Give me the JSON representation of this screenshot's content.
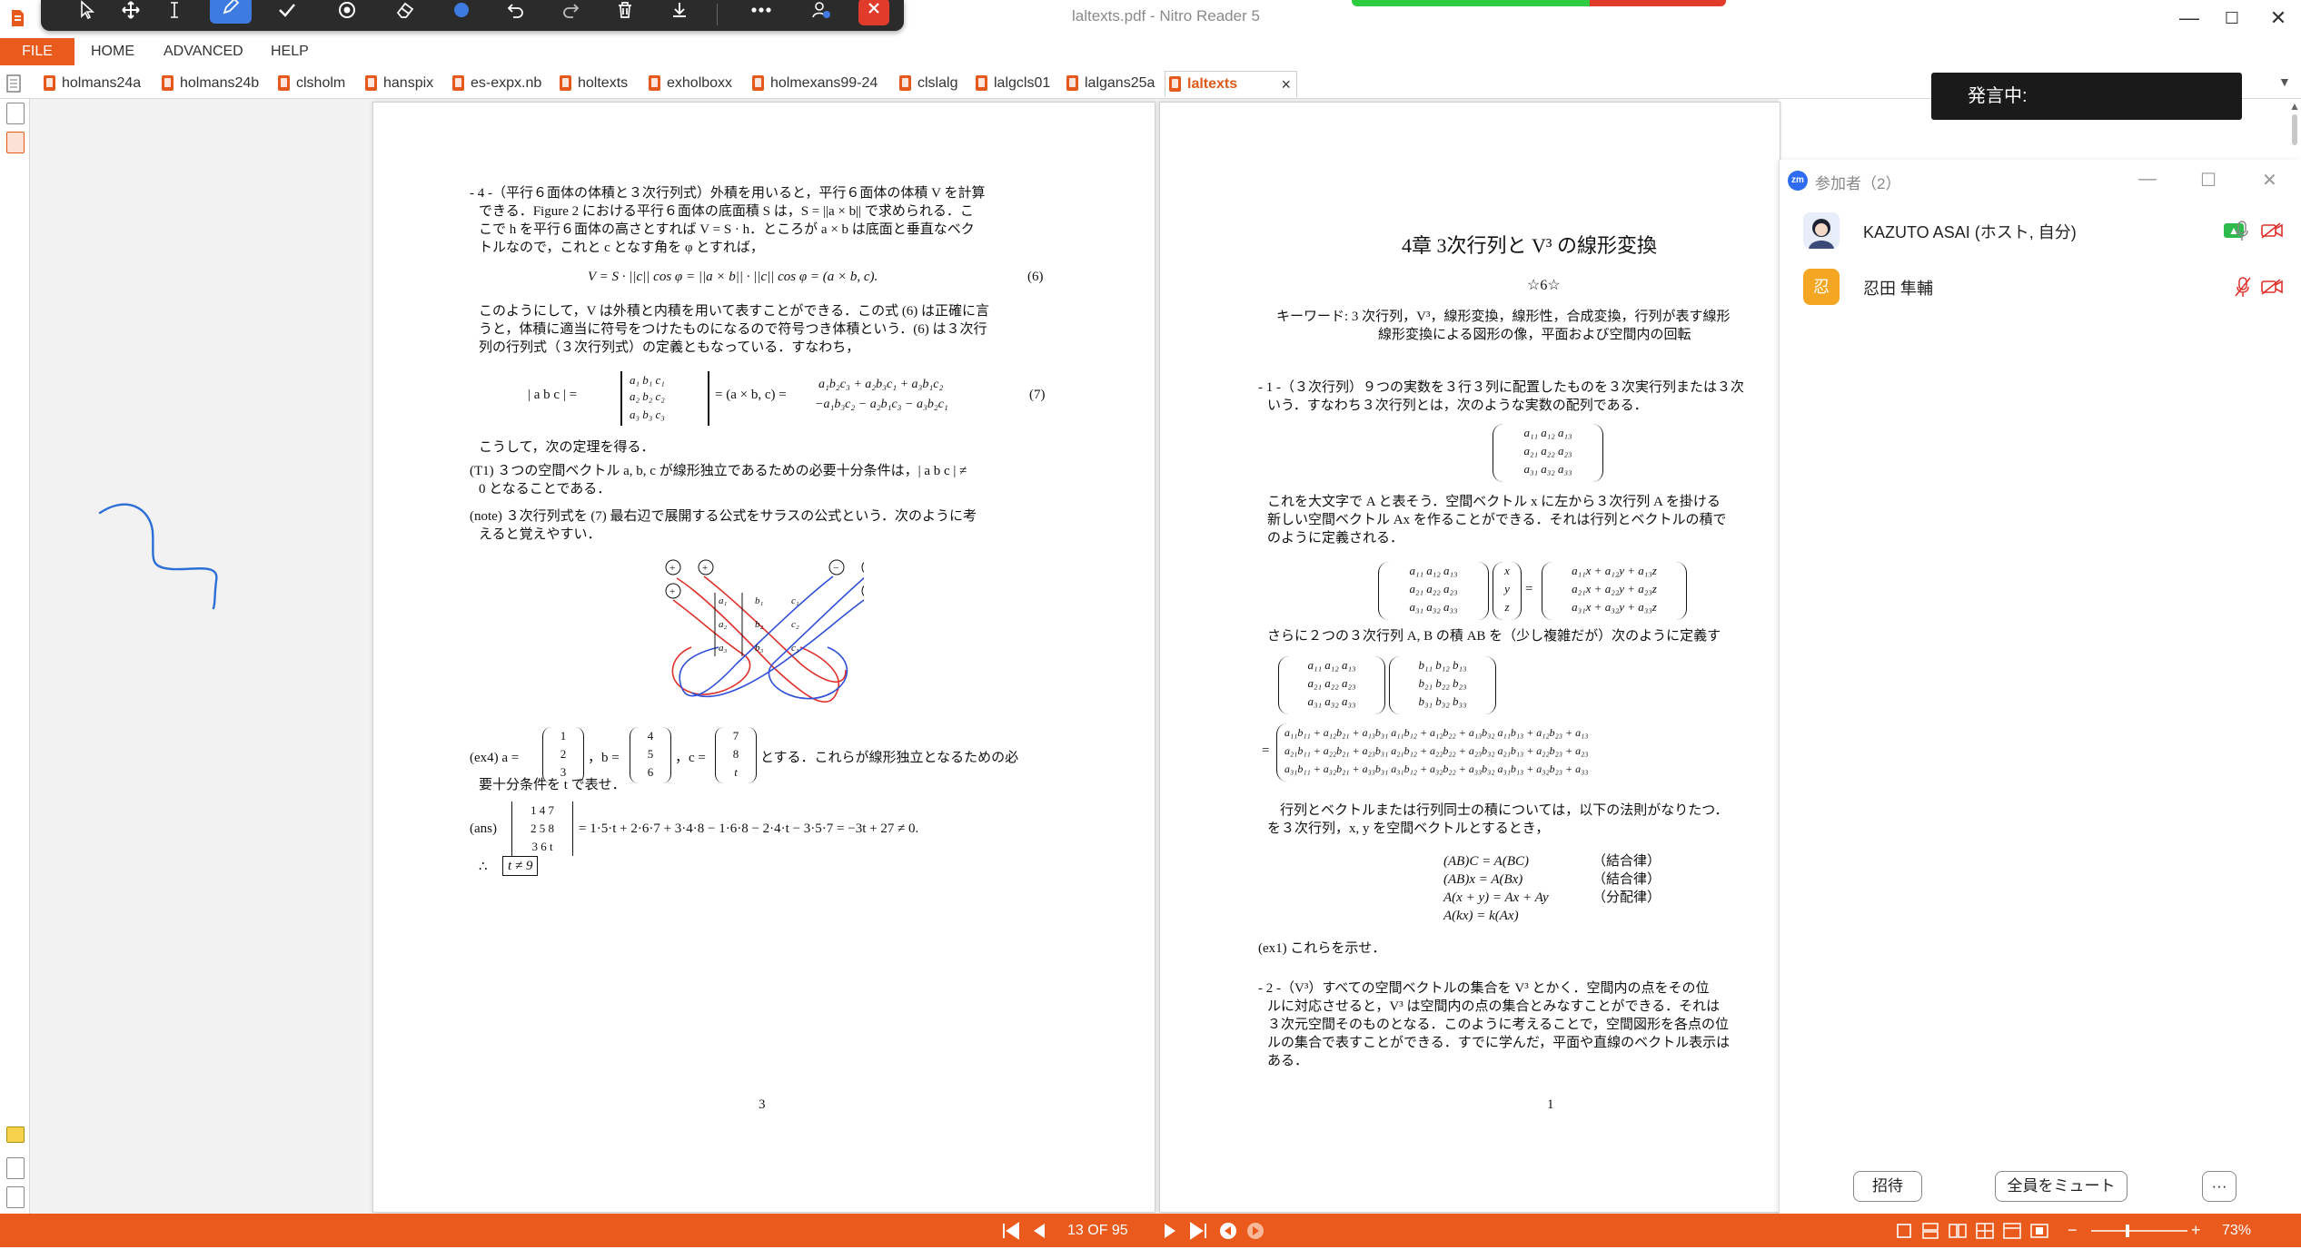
{
  "window": {
    "title": "laltexts.pdf - Nitro Reader 5",
    "minimize": "—",
    "maximize": "☐",
    "close": "✕"
  },
  "annotation_toolbar": {
    "tools": [
      "select-arrow",
      "move",
      "text-cursor",
      "pen",
      "check",
      "stamp",
      "eraser",
      "color",
      "undo",
      "redo",
      "delete",
      "save",
      "more",
      "share",
      "close"
    ]
  },
  "menu": {
    "file": "FILE",
    "home": "HOME",
    "advanced": "ADVANCED",
    "help": "HELP"
  },
  "tabs": [
    {
      "label": "holmans24a"
    },
    {
      "label": "holmans24b"
    },
    {
      "label": "clsholm"
    },
    {
      "label": "hanspix"
    },
    {
      "label": "es-expx.nb"
    },
    {
      "label": "holtexts"
    },
    {
      "label": "exholboxx"
    },
    {
      "label": "holmexans99-24"
    },
    {
      "label": "clslalg"
    },
    {
      "label": "lalgcls01"
    },
    {
      "label": "lalgans25a"
    },
    {
      "label": "laltexts",
      "active": true
    }
  ],
  "left_page": {
    "page_number": "3",
    "lines": [
      "- 4 -（平行６面体の体積と３次行列式）外積を用いると，平行６面体の体積 V を計算",
      "できる．Figure 2 における平行６面体の底面積 S は，S = ||a × b|| で求められる．こ",
      "こで h を平行６面体の高さとすれば V = S · h．ところが a × b は底面と垂直なベク",
      "トルなので，これと c となす角を φ とすれば，",
      "V = S · ||c|| cos φ = ||a × b|| · ||c|| cos φ = (a × b, c).",
      "(6)",
      "このようにして，V は外積と内積を用いて表すことができる．この式 (6) は正確に言",
      "うと，体積に適当に符号をつけたものになるので符号つき体積という．(6) は３次行",
      "列の行列式（３次行列式）の定義ともなっている．すなわち，",
      "| a  b  c | =",
      "a₁  b₁  c₁",
      "a₂  b₂  c₂",
      "a₃  b₃  c₃",
      "= (a × b, c) =",
      "a₁b₂c₃ + a₂b₃c₁ + a₃b₁c₂",
      "−a₁b₃c₂ − a₂b₁c₃ − a₃b₂c₁",
      "(7)",
      "こうして，次の定理を得る．",
      "(T1) ３つの空間ベクトル a, b, c が線形独立であるための必要十分条件は，| a  b  c | ≠",
      "0 となることである．",
      "(note) ３次行列式を (7) 最右辺で展開する公式をサラスの公式という．次のように考",
      "えると覚えやすい．",
      "(ex4)  a =",
      "，b =",
      "，c =",
      "とする．これらが線形独立となるための必",
      "要十分条件を t で表せ．",
      "(ans)",
      "= 1·5·t + 2·6·7 + 3·4·8 − 1·6·8 − 2·4·t − 3·5·7 = −3t + 27 ≠ 0.",
      "∴",
      "t ≠ 9"
    ],
    "vec_a": [
      "1",
      "2",
      "3"
    ],
    "vec_b": [
      "4",
      "5",
      "6"
    ],
    "vec_c": [
      "7",
      "8",
      "t"
    ],
    "det_rows": [
      "1  4  7",
      "2  5  8",
      "3  6  t"
    ],
    "sarrus_signs": [
      "+",
      "+",
      "+",
      "−",
      "−",
      "−"
    ],
    "sarrus_cells": [
      "a₁",
      "b₁",
      "c₁",
      "a₂",
      "b₂",
      "c₂",
      "a₃",
      "b₃",
      "c₃"
    ]
  },
  "right_page": {
    "page_number": "1",
    "chapter_title": "4章  3次行列と V³ の線形変換",
    "stars": "☆6☆",
    "lines": [
      "キーワード: 3 次行列，V³，線形変換，線形性，合成変換，行列が表す線形",
      "線形変換による図形の像，平面および空間内の回転",
      "- 1 -（３次行列）９つの実数を３行３列に配置したものを３次実行列または３次",
      "いう．すなわち３次行列とは，次のような実数の配列である．",
      "これを大文字で A と表そう．空間ベクトル x に左から３次行列 A を掛ける",
      "新しい空間ベクトル Ax を作ることができる．それは行列とベクトルの積で",
      "のように定義される．",
      "さらに２つの３次行列 A, B の積 AB を（少し複雑だが）次のように定義す",
      "行列とベクトルまたは行列同士の積については，以下の法則がなりたつ．",
      "を３次行列，x, y を空間ベクトルとするとき，",
      "(AB)C = A(BC)",
      "(AB)x = A(Bx)",
      "A(x + y) = Ax + Ay",
      "A(kx) = k(Ax)",
      "（結合律）",
      "（結合律）",
      "（分配律）",
      "(ex1)  これらを示せ．",
      "- 2 -（V³）すべての空間ベクトルの集合を V³ とかく．空間内の点をその位",
      "ルに対応させると，V³ は空間内の点の集合とみなすことができる．それは",
      "３次元空間そのものとなる．このように考えることで，空間図形を各点の位",
      "ルの集合で表すことができる．すでに学んだ，平面や直線のベクトル表示は",
      "ある．"
    ],
    "matrix_a": [
      "a₁₁  a₁₂  a₁₃",
      "a₂₁  a₂₂  a₂₃",
      "a₃₁  a₃₂  a₃₃"
    ],
    "vec_xyz": [
      "x",
      "y",
      "z"
    ],
    "ax_result": [
      "a₁₁x + a₁₂y + a₁₃z",
      "a₂₁x + a₂₂y + a₂₃z",
      "a₃₁x + a₃₂y + a₃₃z"
    ],
    "matrix_b": [
      "b₁₁  b₁₂  b₁₃",
      "b₂₁  b₂₂  b₂₃",
      "b₃₁  b₃₂  b₃₃"
    ],
    "ab_result": [
      "a₁₁b₁₁ + a₁₂b₂₁ + a₁₃b₃₁   a₁₁b₁₂ + a₁₂b₂₂ + a₁₃b₃₂   a₁₁b₁₃ + a₁₂b₂₃ + a₁₃",
      "a₂₁b₁₁ + a₂₂b₂₁ + a₂₃b₃₁   a₂₁b₁₂ + a₂₂b₂₂ + a₂₃b₃₂   a₂₁b₁₃ + a₂₂b₂₃ + a₂₃",
      "a₃₁b₁₁ + a₃₂b₂₁ + a₃₃b₃₁   a₃₁b₁₂ + a₃₂b₂₂ + a₃₃b₃₂   a₃₁b₁₃ + a₃₂b₂₃ + a₃₃"
    ]
  },
  "zoom": {
    "speaking_label": "発言中:",
    "logo": "zm",
    "panel_title": "参加者（2）",
    "participants": [
      {
        "name": "KAZUTO ASAI (ホスト, 自分)",
        "avatar_color": "#dfe7f5"
      },
      {
        "name": "忍田 隼輔",
        "avatar_text": "忍",
        "avatar_color": "#f5a623"
      }
    ],
    "invite_button": "招待",
    "mute_all_button": "全員をミュート",
    "more_button": "···"
  },
  "status": {
    "page_indicator": "13 OF 95",
    "zoom_level": "73%"
  },
  "colors": {
    "brand_orange": "#ea5a1c",
    "pen_blue": "#2b6fd6",
    "sarrus_red": "#e0302a",
    "sarrus_blue": "#2f4fd8"
  }
}
